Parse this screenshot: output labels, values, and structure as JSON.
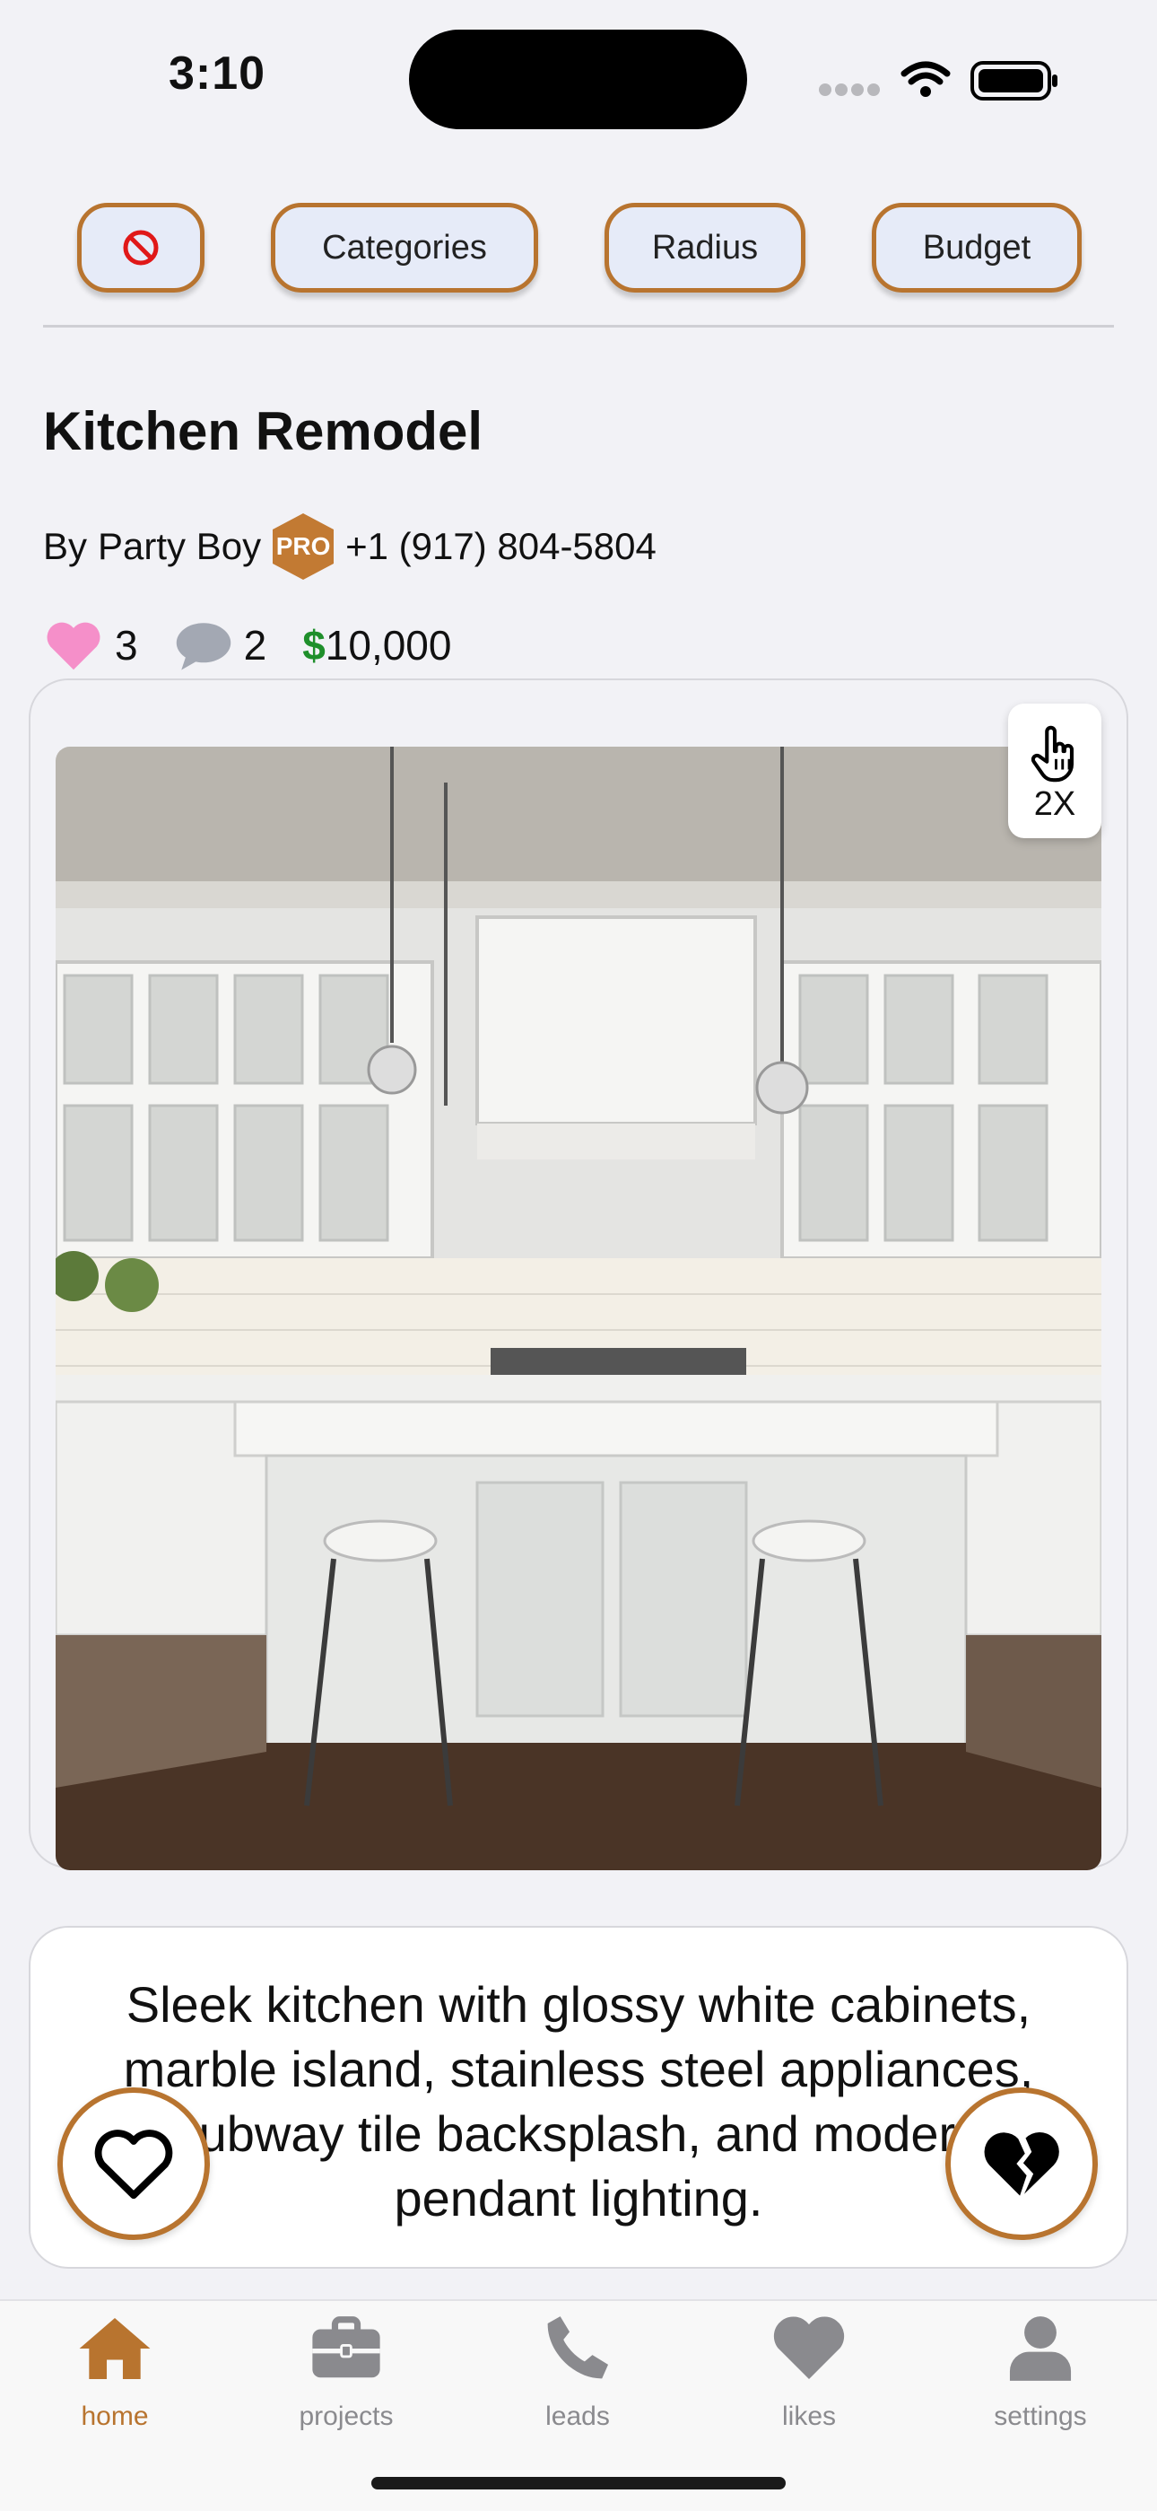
{
  "status_bar": {
    "time": "3:10"
  },
  "filters": {
    "clear_icon": "no-entry-icon",
    "categories_label": "Categories",
    "radius_label": "Radius",
    "budget_label": "Budget"
  },
  "project": {
    "title": "Kitchen Remodel",
    "by_prefix": "By",
    "author": "Party Boy",
    "badge": "PRO",
    "phone": "+1 (917) 804-5804",
    "likes": "3",
    "comments": "2",
    "price_sign": "$",
    "price": "10,000",
    "zoom_hint": "2X",
    "description": "Sleek kitchen with glossy white cabinets, marble island, stainless steel appliances, subway tile backsplash, and modern pendant lighting."
  },
  "tabs": [
    {
      "label": "home",
      "icon": "home-icon",
      "active": true
    },
    {
      "label": "projects",
      "icon": "briefcase-icon",
      "active": false
    },
    {
      "label": "leads",
      "icon": "phone-icon",
      "active": false
    },
    {
      "label": "likes",
      "icon": "heart-icon",
      "active": false
    },
    {
      "label": "settings",
      "icon": "person-icon",
      "active": false
    }
  ],
  "colors": {
    "accent": "#b8742f",
    "price": "#1f8f2b",
    "like": "#f58fc9"
  }
}
